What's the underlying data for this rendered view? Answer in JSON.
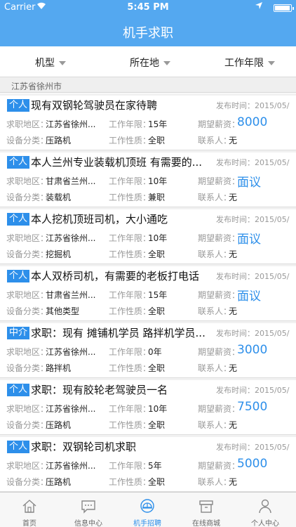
{
  "status_bar": {
    "carrier": "Carrier",
    "time": "5:45 PM",
    "battery_level": 0.95
  },
  "header": {
    "title": "机手求职"
  },
  "filters": [
    {
      "label": "机型"
    },
    {
      "label": "所在地"
    },
    {
      "label": "工作年限"
    }
  ],
  "region": "江苏省徐州市",
  "labels": {
    "location": "求职地区：",
    "category": "设备分类：",
    "years": "工作年限：",
    "nature": "工作性质：",
    "salary": "期望薪资：",
    "contact": "联系人：",
    "date": "发布时间："
  },
  "listings": [
    {
      "badge": "个人",
      "title": "现有双钢轮驾驶员在家待聘",
      "date": "2015/05/",
      "location": "江苏省徐州...",
      "years": "15年",
      "salary": "8000",
      "category": "压路机",
      "nature": "全职",
      "contact": "无"
    },
    {
      "badge": "个人",
      "title": "本人兰州专业装载机顶班 有需要的...",
      "date": "2015/05/",
      "location": "甘肃省兰州...",
      "years": "10年",
      "salary": "面议",
      "category": "装载机",
      "nature": "兼职",
      "contact": "无"
    },
    {
      "badge": "个人",
      "title": "本人挖机顶班司机，大小通吃",
      "date": "2015/05/",
      "location": "江苏省徐州...",
      "years": "10年",
      "salary": "面议",
      "category": "挖掘机",
      "nature": "全职",
      "contact": "无"
    },
    {
      "badge": "个人",
      "title": "本人双桥司机，有需要的老板打电话",
      "date": "2015/05/",
      "location": "甘肃省兰州...",
      "years": "15年",
      "salary": "面议",
      "category": "其他类型",
      "nature": "全职",
      "contact": "无"
    },
    {
      "badge": "中介",
      "title": "求职：现有 摊铺机学员 路拌机学员...",
      "date": "2015/05/",
      "location": "江苏省徐州...",
      "years": "0年",
      "salary": "3000",
      "category": "路拌机",
      "nature": "全职",
      "contact": "无"
    },
    {
      "badge": "个人",
      "title": "求职：现有胶轮老驾驶员一名",
      "date": "2015/05/",
      "location": "江苏省徐州...",
      "years": "10年",
      "salary": "7500",
      "category": "压路机",
      "nature": "全职",
      "contact": "无"
    },
    {
      "badge": "个人",
      "title": "求职：双钢轮司机求职",
      "date": "2015/05/",
      "location": "江苏省徐州...",
      "years": "5年",
      "salary": "5000",
      "category": "压路机",
      "nature": "全职",
      "contact": "无"
    }
  ],
  "tabs": [
    {
      "label": "首页",
      "icon": "home-icon",
      "active": false
    },
    {
      "label": "信息中心",
      "icon": "chat-bubble-icon",
      "active": false
    },
    {
      "label": "机手招聘",
      "icon": "helmet-icon",
      "active": true
    },
    {
      "label": "在线商城",
      "icon": "store-box-icon",
      "active": false
    },
    {
      "label": "个人中心",
      "icon": "person-icon",
      "active": false
    }
  ],
  "colors": {
    "primary": "#54a8f0",
    "accent": "#2d8fea",
    "muted": "#999999"
  }
}
